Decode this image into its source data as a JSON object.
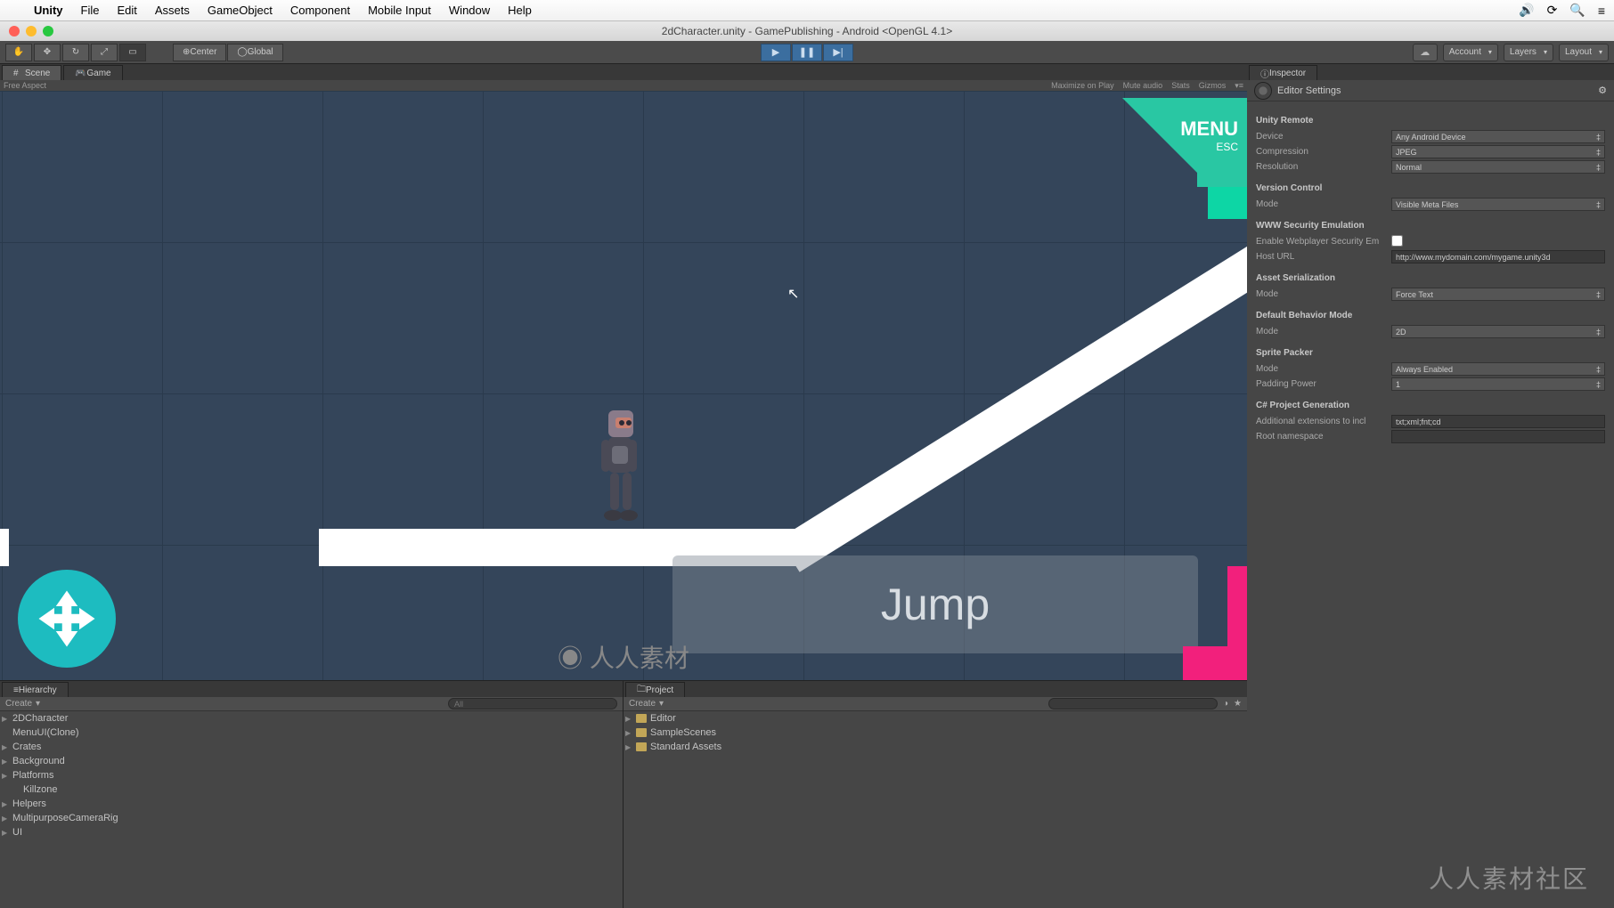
{
  "menubar": {
    "app": "Unity",
    "items": [
      "File",
      "Edit",
      "Assets",
      "GameObject",
      "Component",
      "Mobile Input",
      "Window",
      "Help"
    ]
  },
  "titlebar": "2dCharacter.unity - GamePublishing - Android <OpenGL 4.1>",
  "toolbar": {
    "pivot1": "Center",
    "pivot2": "Global",
    "account": "Account",
    "layers": "Layers",
    "layout": "Layout"
  },
  "tabs": {
    "scene": "Scene",
    "game": "Game",
    "hierarchy": "Hierarchy",
    "project": "Project",
    "inspector": "Inspector"
  },
  "gameBar": {
    "aspect": "Free Aspect",
    "max": "Maximize on Play",
    "mute": "Mute audio",
    "stats": "Stats",
    "gizmos": "Gizmos"
  },
  "gameUI": {
    "menu": "MENU",
    "esc": "ESC",
    "jump": "Jump"
  },
  "hierarchy": {
    "create": "Create",
    "search_ph": "All",
    "items": [
      "2DCharacter",
      "MenuUI(Clone)",
      "Crates",
      "Background",
      "Platforms",
      "Killzone",
      "Helpers",
      "MultipurposeCameraRig",
      "UI"
    ]
  },
  "project": {
    "create": "Create",
    "items": [
      "Editor",
      "SampleScenes",
      "Standard Assets"
    ]
  },
  "inspector": {
    "title": "Editor Settings",
    "sections": {
      "remote": {
        "title": "Unity Remote",
        "device_l": "Device",
        "device_v": "Any Android Device",
        "comp_l": "Compression",
        "comp_v": "JPEG",
        "res_l": "Resolution",
        "res_v": "Normal"
      },
      "vc": {
        "title": "Version Control",
        "mode_l": "Mode",
        "mode_v": "Visible Meta Files"
      },
      "www": {
        "title": "WWW Security Emulation",
        "enable_l": "Enable Webplayer Security Em",
        "host_l": "Host URL",
        "host_v": "http://www.mydomain.com/mygame.unity3d"
      },
      "asset": {
        "title": "Asset Serialization",
        "mode_l": "Mode",
        "mode_v": "Force Text"
      },
      "behav": {
        "title": "Default Behavior Mode",
        "mode_l": "Mode",
        "mode_v": "2D"
      },
      "sprite": {
        "title": "Sprite Packer",
        "mode_l": "Mode",
        "mode_v": "Always Enabled",
        "pad_l": "Padding Power",
        "pad_v": "1"
      },
      "cs": {
        "title": "C# Project Generation",
        "ext_l": "Additional extensions to incl",
        "ext_v": "txt;xml;fnt;cd",
        "ns_l": "Root namespace",
        "ns_v": ""
      }
    }
  },
  "watermark_r": "人人素材社区",
  "watermark_c": "人人素材"
}
